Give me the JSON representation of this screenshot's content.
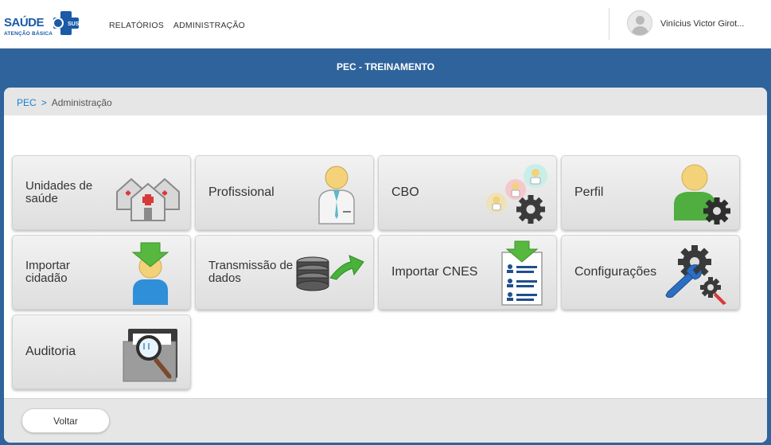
{
  "brand": {
    "name": "SAÚDE",
    "badge": "SUS",
    "subtitle": "ATENÇÃO BÁSICA"
  },
  "topnav": {
    "items": [
      "RELATÓRIOS",
      "ADMINISTRAÇÃO"
    ]
  },
  "user": {
    "name": "Vinícius Victor Girot..."
  },
  "system_title": "PEC - TREINAMENTO",
  "breadcrumb": {
    "root": "PEC",
    "separator": ">",
    "current": "Administração"
  },
  "tiles": [
    {
      "label": "Unidades de saúde",
      "icon": "health-units-icon"
    },
    {
      "label": "Profissional",
      "icon": "professional-icon"
    },
    {
      "label": "CBO",
      "icon": "cbo-icon"
    },
    {
      "label": "Perfil",
      "icon": "profile-gear-icon"
    },
    {
      "label": "Importar cidadão",
      "icon": "import-citizen-icon"
    },
    {
      "label": "Transmissão de dados",
      "icon": "data-transmission-icon"
    },
    {
      "label": "Importar CNES",
      "icon": "import-cnes-icon"
    },
    {
      "label": "Configurações",
      "icon": "settings-wrench-icon"
    },
    {
      "label": "Auditoria",
      "icon": "audit-magnifier-icon"
    }
  ],
  "footer": {
    "back_label": "Voltar"
  }
}
